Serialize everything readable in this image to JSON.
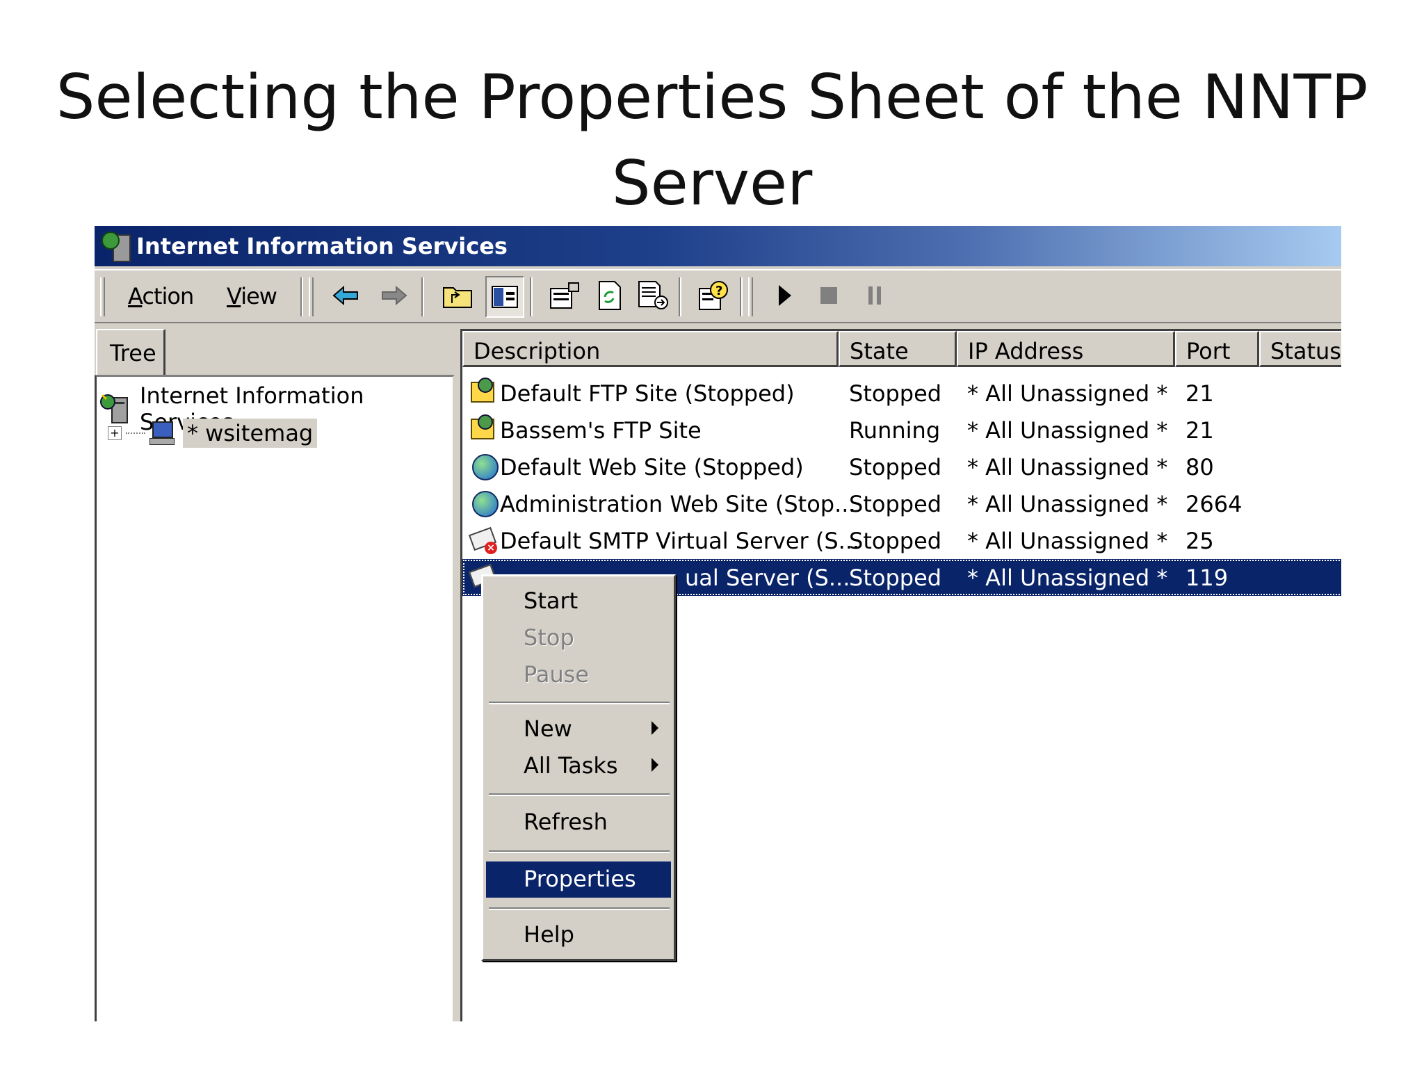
{
  "slide": {
    "title_line1": "Selecting the Properties Sheet of the  NNTP",
    "title_line2": "Server"
  },
  "window": {
    "title": "Internet Information Services"
  },
  "toolbar": {
    "menus": [
      "Action",
      "View"
    ],
    "buttons": [
      "back-arrow-icon",
      "forward-arrow-icon",
      "up-folder-icon",
      "show-hide-tree-icon",
      "properties-icon",
      "refresh-icon",
      "export-list-icon",
      "help-icon",
      "start-icon",
      "stop-icon",
      "pause-icon"
    ]
  },
  "tree": {
    "tab_label": "Tree",
    "root_label": "Internet Information Services",
    "child_label": "* wsitemag",
    "expander": "+"
  },
  "list": {
    "columns": [
      "Description",
      "State",
      "IP Address",
      "Port",
      "Status"
    ],
    "rows": [
      {
        "icon": "ftp-site-icon",
        "description": "Default FTP Site (Stopped)",
        "state": "Stopped",
        "ip": "* All Unassigned *",
        "port": "21",
        "status": ""
      },
      {
        "icon": "ftp-site-icon",
        "description": "Bassem's FTP Site",
        "state": "Running",
        "ip": "* All Unassigned *",
        "port": "21",
        "status": ""
      },
      {
        "icon": "web-site-icon",
        "description": "Default Web Site (Stopped)",
        "state": "Stopped",
        "ip": "* All Unassigned *",
        "port": "80",
        "status": ""
      },
      {
        "icon": "web-site-icon",
        "description": "Administration Web Site (Stop...",
        "state": "Stopped",
        "ip": "* All Unassigned *",
        "port": "2664",
        "status": ""
      },
      {
        "icon": "smtp-server-icon",
        "description": "Default SMTP Virtual Server (S...",
        "state": "Stopped",
        "ip": "* All Unassigned *",
        "port": "25",
        "status": ""
      },
      {
        "icon": "nntp-server-icon",
        "description": "ual Server (S...",
        "state": "Stopped",
        "ip": "* All Unassigned *",
        "port": "119",
        "status": "",
        "selected": true
      }
    ]
  },
  "context_menu": {
    "items": [
      {
        "label": "Start",
        "key": "S",
        "enabled": true
      },
      {
        "label": "Stop",
        "key": "",
        "enabled": false
      },
      {
        "label": "Pause",
        "key": "",
        "enabled": false
      },
      {
        "label": "New",
        "key": "N",
        "enabled": true,
        "submenu": true
      },
      {
        "label": "All Tasks",
        "key": "k",
        "enabled": true,
        "submenu": true
      },
      {
        "label": "Refresh",
        "key": "f",
        "enabled": true
      },
      {
        "label": "Properties",
        "key": "o",
        "enabled": true,
        "highlighted": true
      },
      {
        "label": "Help",
        "key": "H",
        "enabled": true
      }
    ]
  }
}
